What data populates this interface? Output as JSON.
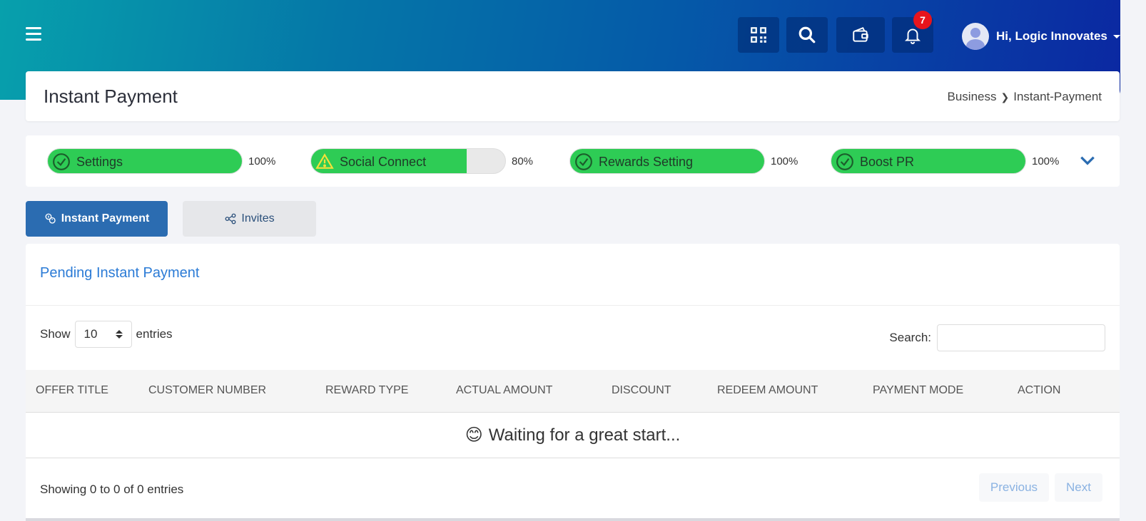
{
  "header": {
    "user_greeting": "Hi, Logic Innovates",
    "notification_count": "7"
  },
  "page": {
    "title": "Instant Payment",
    "breadcrumb": [
      "Business",
      "Instant-Payment"
    ]
  },
  "progress": [
    {
      "label": "Settings",
      "percent_text": "100%",
      "fill": 100,
      "status": "complete"
    },
    {
      "label": "Social Connect",
      "percent_text": "80%",
      "fill": 80,
      "status": "warning"
    },
    {
      "label": "Rewards Setting",
      "percent_text": "100%",
      "fill": 100,
      "status": "complete"
    },
    {
      "label": "Boost PR",
      "percent_text": "100%",
      "fill": 100,
      "status": "complete"
    }
  ],
  "tabs": {
    "instant_payment": "Instant Payment",
    "invites": "Invites"
  },
  "table": {
    "section_title": "Pending Instant Payment",
    "show_label": "Show",
    "entries_value": "10",
    "entries_label": "entries",
    "search_label": "Search:",
    "search_placeholder": "",
    "columns": [
      "OFFER TITLE",
      "CUSTOMER NUMBER",
      "REWARD TYPE",
      "ACTUAL AMOUNT",
      "DISCOUNT",
      "REDEEM AMOUNT",
      "PAYMENT MODE",
      "ACTION"
    ],
    "empty_message": "Waiting for a great start...",
    "empty_emoji": "😊",
    "info": "Showing 0 to 0 of 0 entries",
    "prev_label": "Previous",
    "next_label": "Next"
  },
  "colors": {
    "accent_blue": "#2b6cb1",
    "progress_green": "#2ecc55",
    "link_blue": "#2b7bd6",
    "badge_red": "#e8141c"
  }
}
